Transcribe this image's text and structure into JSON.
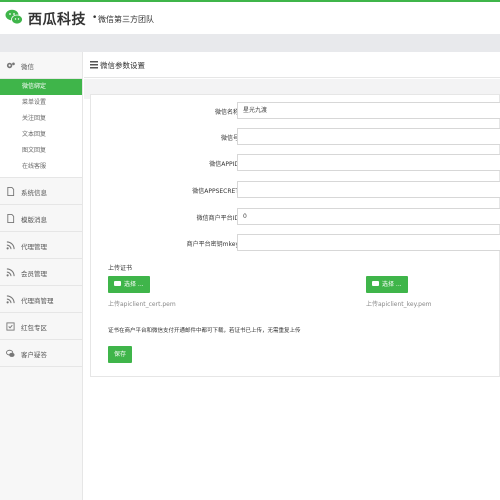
{
  "header": {
    "brand": "西瓜科技",
    "dot": "•",
    "tagline": "微信第三方团队",
    "accent": "#3fb54a"
  },
  "sidebar": {
    "wechat_group": "微信",
    "wechat_items": [
      "微信绑定",
      "菜单设置",
      "关注回复",
      "文本回复",
      "图文回复",
      "在线客服"
    ],
    "active_item": "微信绑定",
    "groups": [
      {
        "label": "系统信息",
        "icon": "document-icon"
      },
      {
        "label": "模版消息",
        "icon": "document-icon"
      },
      {
        "label": "代理管理",
        "icon": "rss-icon"
      },
      {
        "label": "会员管理",
        "icon": "rss-icon"
      },
      {
        "label": "代理商管理",
        "icon": "rss-icon"
      },
      {
        "label": "红包专区",
        "icon": "checkbox-icon"
      },
      {
        "label": "客户疑答",
        "icon": "chat-icon"
      }
    ]
  },
  "page": {
    "title": "微信参数设置"
  },
  "form": {
    "name_label": "微信名称",
    "name_value": "星光九渡",
    "id_label": "微信号",
    "id_value": "",
    "appid_label": "微信APPID",
    "appid_value": "",
    "secret_label": "微信APPSECRET",
    "secret_value": "",
    "mch_label": "微信商户平台ID",
    "mch_value": "0",
    "mkey_label": "商户平台密钥mkey",
    "mkey_value": ""
  },
  "upload": {
    "title": "上传证书",
    "choose_label": "选择 ...",
    "cert_file": "上传apiclient_cert.pem",
    "key_file": "上传apiclient_key.pem",
    "notice": "证书在商户平台和微信支付开通邮件中都可下载，若证书已上传，无需重复上传",
    "save_label": "保存"
  }
}
